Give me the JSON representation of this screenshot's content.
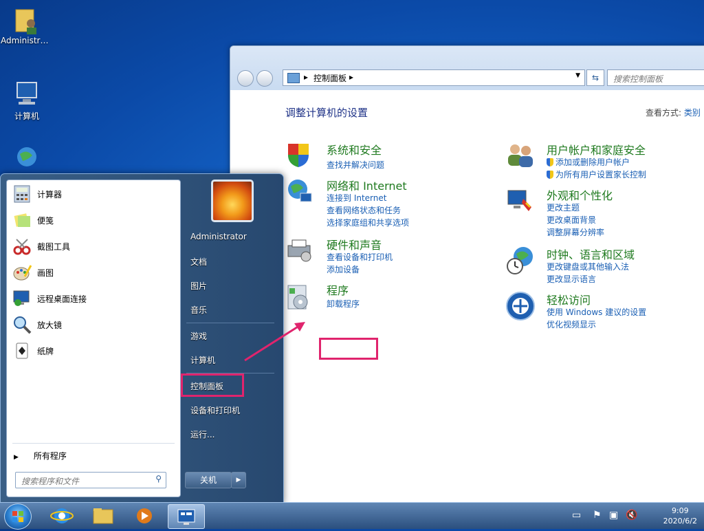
{
  "desktop": {
    "icons": [
      {
        "label": "Administra..."
      },
      {
        "label": "计算机"
      }
    ]
  },
  "control_panel": {
    "breadcrumb": "控制面板",
    "search_placeholder": "搜索控制面板",
    "heading": "调整计算机的设置",
    "view_by_label": "查看方式:",
    "view_by_value": "类别",
    "categories": [
      {
        "title": "系统和安全",
        "links": [
          "查找并解决问题"
        ]
      },
      {
        "title": "网络和 Internet",
        "links": [
          "连接到 Internet",
          "查看网络状态和任务",
          "选择家庭组和共享选项"
        ]
      },
      {
        "title": "硬件和声音",
        "links": [
          "查看设备和打印机",
          "添加设备"
        ]
      },
      {
        "title": "程序",
        "links": [
          "卸载程序"
        ]
      },
      {
        "title": "用户帐户和家庭安全",
        "links": [
          "添加或删除用户帐户",
          "为所有用户设置家长控制"
        ]
      },
      {
        "title": "外观和个性化",
        "links": [
          "更改主题",
          "更改桌面背景",
          "调整屏幕分辨率"
        ]
      },
      {
        "title": "时钟、语言和区域",
        "links": [
          "更改键盘或其他输入法",
          "更改显示语言"
        ]
      },
      {
        "title": "轻松访问",
        "links": [
          "使用 Windows 建议的设置",
          "优化视频显示"
        ]
      }
    ]
  },
  "start_menu": {
    "programs": [
      "计算器",
      "便笺",
      "截图工具",
      "画图",
      "远程桌面连接",
      "放大镜",
      "纸牌"
    ],
    "all_programs": "所有程序",
    "search_placeholder": "搜索程序和文件",
    "user": "Administrator",
    "right_items": [
      "文档",
      "图片",
      "音乐",
      "游戏",
      "计算机",
      "控制面板",
      "设备和打印机",
      "运行..."
    ],
    "shutdown": "关机"
  },
  "taskbar": {
    "time": "9:09",
    "date": "2020/6/2"
  },
  "colors": {
    "highlight": "#e0246d",
    "link": "#1a5fb4",
    "category_title": "#1f7a1f"
  }
}
